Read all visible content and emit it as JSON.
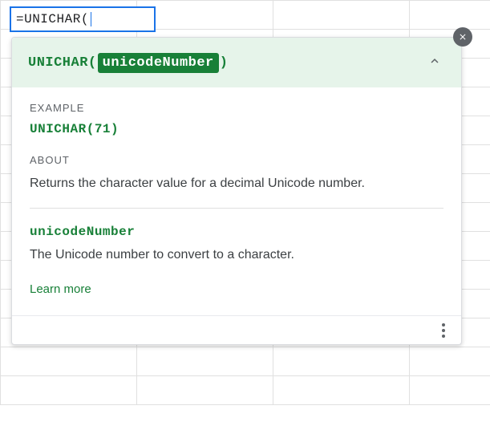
{
  "formula_input": "=UNICHAR(",
  "tooltip": {
    "function_name": "UNICHAR",
    "open_paren": "(",
    "param_highlight": "unicodeNumber",
    "close_paren": ")",
    "example_label": "EXAMPLE",
    "example_value": "UNICHAR(71)",
    "about_label": "ABOUT",
    "about_desc": "Returns the character value for a decimal Unicode number.",
    "param_name": "unicodeNumber",
    "param_desc": "The Unicode number to convert to a character.",
    "learn_more": "Learn more"
  }
}
